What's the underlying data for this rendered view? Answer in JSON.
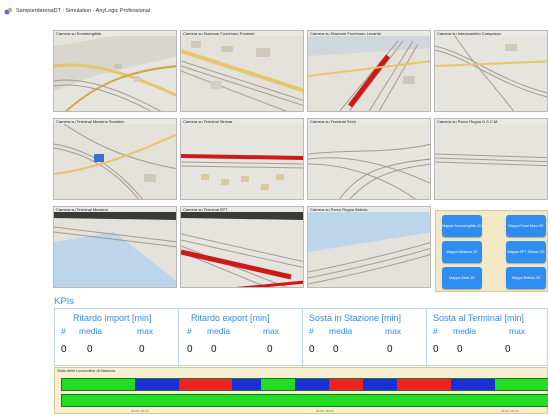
{
  "window": {
    "title": "SampierdarenaDT : Simulation - AnyLogic Professional"
  },
  "cameras": [
    {
      "label": "Camera su Sommergibile"
    },
    {
      "label": "Camera su Stazione Fuorimuro Ponente"
    },
    {
      "label": "Camera su Stazione Fuorimuro Levante"
    },
    {
      "label": "Camera su Interscambio Campasso"
    },
    {
      "label": "Camera su Terminal Messina Scambio"
    },
    {
      "label": "Camera su Terminal Sinmar"
    },
    {
      "label": "Camera su Terminal Sech"
    },
    {
      "label": "Camera su Parco Rugna D.S.C.M."
    },
    {
      "label": "Camera su Terminal Messina"
    },
    {
      "label": "Camera su Terminal SPT"
    },
    {
      "label": "Camera su Parco Rugna Bettolo"
    }
  ],
  "nav_buttons": [
    {
      "label": "Mappa Sommergibile 2D"
    },
    {
      "label": "Mappa Fuori Muro 2D"
    },
    {
      "label": "Mappa Messina 2D"
    },
    {
      "label": "Mappa SPT Sinmar 2D"
    },
    {
      "label": "Mappa Sech 2D"
    },
    {
      "label": "Mappa Bettolo 2D"
    }
  ],
  "kpis": {
    "title": "KPIs",
    "blocks": [
      {
        "title": "Ritardo import [min]",
        "h_count": "#",
        "h_mean": "media",
        "h_max": "max",
        "v_count": "0",
        "v_mean": "0",
        "v_max": "0"
      },
      {
        "title": "Ritardo export  [min]",
        "h_count": "#",
        "h_mean": "media",
        "h_max": "max",
        "v_count": "0",
        "v_mean": "0",
        "v_max": "0"
      },
      {
        "title": "Sosta in Stazione  [min]",
        "h_count": "#",
        "h_mean": "media",
        "h_max": "max",
        "v_count": "0",
        "v_mean": "0",
        "v_max": "0"
      },
      {
        "title": "Sosta al Terminal  [min]",
        "h_count": "#",
        "h_mean": "media",
        "h_max": "max",
        "v_count": "0",
        "v_mean": "0",
        "v_max": "0"
      }
    ]
  },
  "loco": {
    "label": "Stato delle Locomotive di Manovra",
    "colors": {
      "idle": "#22dd22",
      "busy": "#1a2fd6",
      "alarm": "#ee2222"
    },
    "bar1": [
      {
        "state": "idle",
        "frac": 0.15
      },
      {
        "state": "busy",
        "frac": 0.09
      },
      {
        "state": "alarm",
        "frac": 0.11
      },
      {
        "state": "busy",
        "frac": 0.06
      },
      {
        "state": "idle",
        "frac": 0.07
      },
      {
        "state": "busy",
        "frac": 0.07
      },
      {
        "state": "alarm",
        "frac": 0.07
      },
      {
        "state": "busy",
        "frac": 0.07
      },
      {
        "state": "alarm",
        "frac": 0.11
      },
      {
        "state": "busy",
        "frac": 0.09
      },
      {
        "state": "idle",
        "frac": 0.11
      }
    ],
    "bar2": [
      {
        "state": "idle",
        "frac": 1.0
      }
    ],
    "ticks": [
      "00:00 / 00:00",
      "00:00 / 00:00",
      "00:00 / 00:00"
    ]
  }
}
